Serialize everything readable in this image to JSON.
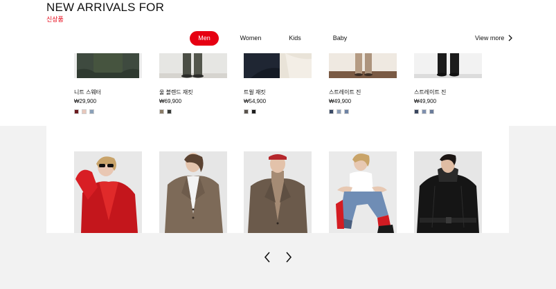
{
  "heading": {
    "title": "NEW ARRIVALS FOR",
    "subtitle": "신상품"
  },
  "tabs": [
    "Men",
    "Women",
    "Kids",
    "Baby"
  ],
  "active_tab": "Men",
  "view_more": {
    "label": "View more",
    "icon": "chevron-right-icon"
  },
  "colors": {
    "accent": "#e60012",
    "band": "#f2f2f2"
  },
  "row1_products": [
    {
      "name": "니트 스웨터",
      "price": "₩29,900",
      "swatches": [
        "#6b1a1e",
        "#e8c8bc",
        "#8aa0b8"
      ]
    },
    {
      "name": "울 블렌드 재킷",
      "price": "₩69,900",
      "swatches": [
        "#8a7c68",
        "#3a3d3a"
      ]
    },
    {
      "name": "트윌 재킷",
      "price": "₩54,900",
      "swatches": [
        "#5a534c",
        "#1e1e1e"
      ]
    },
    {
      "name": "스트레이트 진",
      "price": "₩49,900",
      "swatches": [
        "#3a4a66",
        "#8a9cb6",
        "#6e83a4"
      ]
    },
    {
      "name": "스트레이트 진",
      "price": "₩49,900",
      "swatches": [
        "#39455e",
        "#7e8fae",
        "#6a7b9a"
      ]
    }
  ],
  "row2_products": [
    {
      "image": "model-red-leather-jacket"
    },
    {
      "image": "model-brown-wool-blazer"
    },
    {
      "image": "model-brown-blazer-turtleneck"
    },
    {
      "image": "model-jeans-white-tank"
    },
    {
      "image": "model-black-leather-coat"
    }
  ],
  "pager": {
    "prev_icon": "chevron-left-icon",
    "next_icon": "chevron-right-icon"
  }
}
